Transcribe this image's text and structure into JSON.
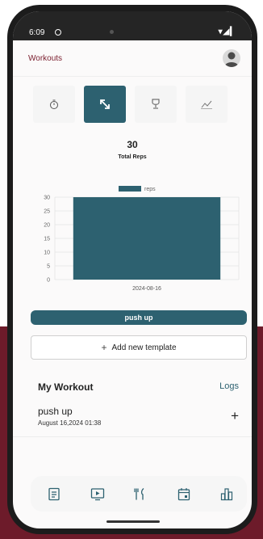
{
  "status_bar": {
    "time": "6:09",
    "right": "▾◢▎"
  },
  "app_bar": {
    "title": "Workouts"
  },
  "tabs": [
    {
      "icon": "stopwatch-icon",
      "active": false
    },
    {
      "icon": "resize-arrows-icon",
      "active": true
    },
    {
      "icon": "trophy-icon",
      "active": false
    },
    {
      "icon": "trend-chart-icon",
      "active": false
    }
  ],
  "stat": {
    "value": "30",
    "label": "Total Reps"
  },
  "chart_data": {
    "type": "bar",
    "categories": [
      "2024-08-16"
    ],
    "series": [
      {
        "name": "reps",
        "values": [
          30
        ]
      }
    ],
    "ylim": [
      0,
      30
    ],
    "yticks": [
      0,
      5,
      10,
      15,
      20,
      25,
      30
    ],
    "legend_position": "top",
    "grid": true,
    "color": "#2d6170"
  },
  "exercise_pill": {
    "label": "push up"
  },
  "add_template": {
    "icon": "+",
    "label": "Add new template"
  },
  "my_workout": {
    "title": "My Workout",
    "logs_label": "Logs",
    "items": [
      {
        "name": "push up",
        "date": "August 16,2024 01:38",
        "action": "+"
      }
    ]
  },
  "bottom_nav": [
    {
      "icon": "document-icon"
    },
    {
      "icon": "play-icon"
    },
    {
      "icon": "fork-knife-icon"
    },
    {
      "icon": "calendar-icon"
    },
    {
      "icon": "bar-chart-icon"
    }
  ],
  "colors": {
    "accent": "#2d6170",
    "title": "#7a1d2d",
    "background": "#6d1b2a"
  }
}
